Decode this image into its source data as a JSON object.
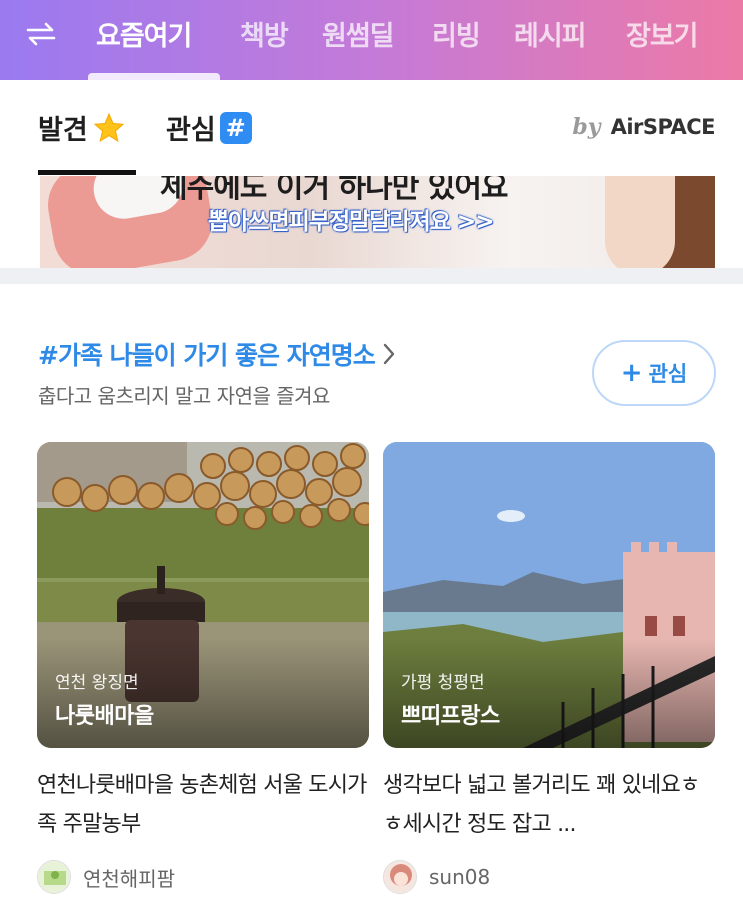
{
  "topnav": {
    "tabs": [
      "요즘여기",
      "책방",
      "원썸딜",
      "리빙",
      "레시피",
      "장보기"
    ],
    "active_index": 0,
    "gradient": [
      "#9a7af0",
      "#ec7aa6"
    ]
  },
  "subtabs": {
    "discover_label": "발견",
    "interest_label": "관심",
    "hash_symbol": "#",
    "by_label": "by",
    "brand_label": "AirSPACE"
  },
  "banner": {
    "headline": "제주에도 이거 하나만 있어요",
    "subline": "뽑아쓰면피부정말달라져요 >>"
  },
  "section": {
    "title": "#가족 나들이 가기 좋은 자연명소",
    "subtitle": "춥다고 움츠리지 말고 자연을 즐겨요",
    "interest_button": "관심",
    "accent_color": "#2e8ae6"
  },
  "cards": [
    {
      "location": "연천 왕징면",
      "place": "나룻배마을",
      "title": "연천나룻배마을 농촌체험 서울 도시가족 주말농부",
      "author": "연천해피팜"
    },
    {
      "location": "가평 청평면",
      "place": "쁘띠프랑스",
      "title": "생각보다 넓고 볼거리도 꽤 있네요ㅎㅎ세시간 정도 잡고 ...",
      "author": "sun08"
    }
  ]
}
